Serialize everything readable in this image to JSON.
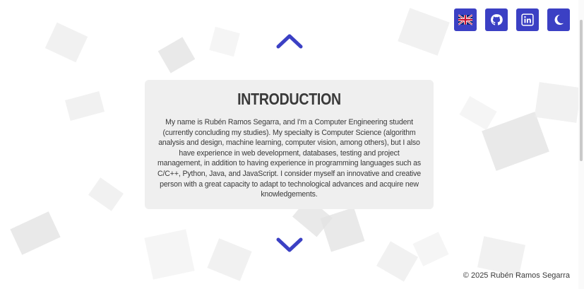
{
  "toolbar": {
    "buttons": [
      {
        "icon": "uk-flag-icon",
        "title": "Language"
      },
      {
        "icon": "github-icon",
        "title": "GitHub"
      },
      {
        "icon": "linkedin-icon",
        "title": "LinkedIn"
      },
      {
        "icon": "moon-icon",
        "title": "Dark mode"
      }
    ]
  },
  "navigation": {
    "up_icon": "chevron-up-icon",
    "down_icon": "chevron-down-icon"
  },
  "intro": {
    "title": "INTRODUCTION",
    "text": "My name is Rubén Ramos Segarra, and I'm a Computer Engineering student (currently concluding my studies). My specialty is Computer Science (algorithm analysis and design, machine learning, computer vision, among others), but I also have experience in web development, databases, testing and project management, in addition to having experience in programming languages such as C/C++, Python, Java, and JavaScript. I consider myself an innovative and creative person with a great capacity to adapt to technological advances and acquire new knowledgements."
  },
  "footer": {
    "copyright": "© 2025 Rubén Ramos Segarra"
  },
  "colors": {
    "accent": "#3b40c4",
    "card_bg": "#efefef",
    "text": "#3a3a3a"
  }
}
